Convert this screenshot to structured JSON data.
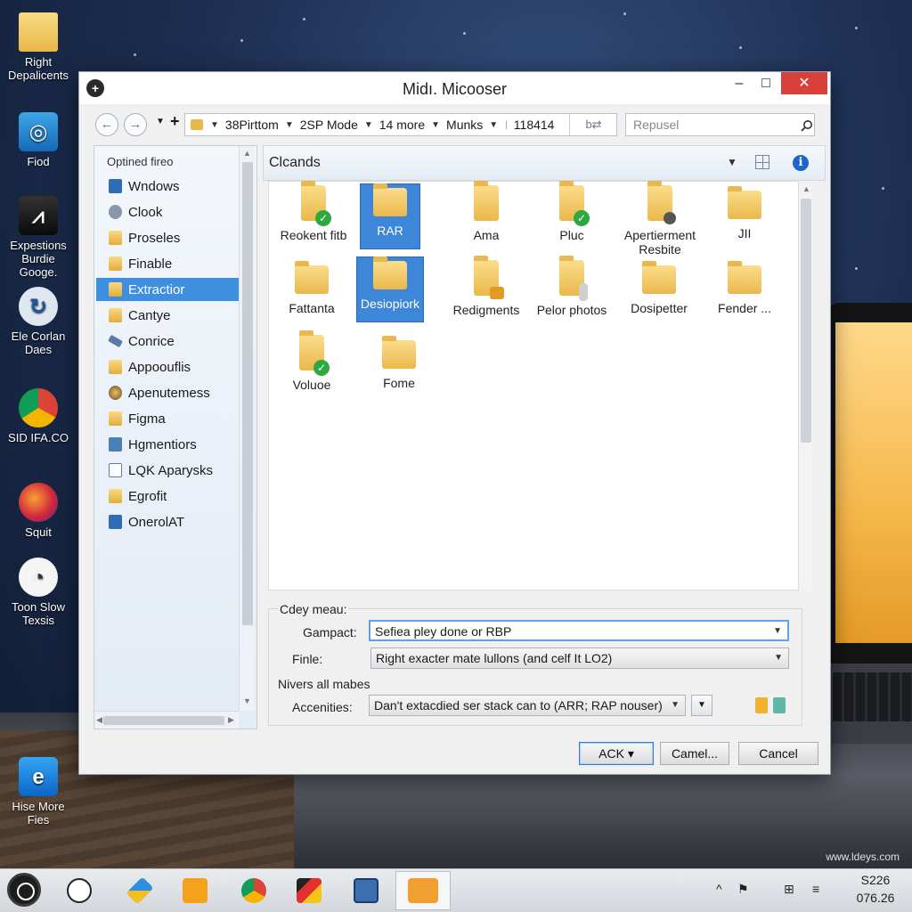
{
  "desktop": {
    "icons": [
      {
        "label": "Right Depalicents",
        "icon": "folder-icon"
      },
      {
        "label": "Fiod",
        "icon": "app-icon"
      },
      {
        "label": "Expestions Burdie Googe.",
        "icon": "media-icon"
      },
      {
        "label": "Ele Corlan Daes",
        "icon": "sync-icon"
      },
      {
        "label": "SID IFA.CO",
        "icon": "chrome-icon"
      },
      {
        "label": "Squit",
        "icon": "orb-icon"
      },
      {
        "label": "Toon Slow Texsis",
        "icon": "clock-icon"
      },
      {
        "label": "Hise More Fies",
        "icon": "ie-icon"
      }
    ],
    "watermark": "www.ldeys.com"
  },
  "dialog": {
    "title": "Midı. Micooser",
    "window_controls": {
      "minimize": "–",
      "maximize": "□",
      "close": "✕"
    },
    "toolbar": {
      "back": "←",
      "forward": "→",
      "plus": "+",
      "address_segments": [
        "38Pirttom",
        "2SP Mode",
        "14 more",
        "Munks",
        "118414"
      ],
      "tools_label": "b⇄",
      "search_placeholder": "Repusel"
    },
    "nav": {
      "header": "Optined fireo",
      "items": [
        {
          "label": "Wndows",
          "icon": "blue",
          "selected": false
        },
        {
          "label": "Clook",
          "icon": "gray",
          "selected": false
        },
        {
          "label": "Proseles",
          "icon": "folder",
          "selected": false
        },
        {
          "label": "Finable",
          "icon": "folder",
          "selected": false
        },
        {
          "label": "Extractior",
          "icon": "folder",
          "selected": true
        },
        {
          "label": "Cantye",
          "icon": "folder",
          "selected": false
        },
        {
          "label": "Conrice",
          "icon": "tool",
          "selected": false
        },
        {
          "label": "Appoouflis",
          "icon": "folder",
          "selected": false
        },
        {
          "label": "Apenutemess",
          "icon": "globe",
          "selected": false
        },
        {
          "label": "Figma",
          "icon": "folder",
          "selected": false
        },
        {
          "label": "Hgmentiors",
          "icon": "pic",
          "selected": false
        },
        {
          "label": "LQK Aparysks",
          "icon": "doc",
          "selected": false
        },
        {
          "label": "Egrofit",
          "icon": "folder",
          "selected": false
        },
        {
          "label": "OnerolAT",
          "icon": "blue",
          "selected": false
        }
      ]
    },
    "content": {
      "title": "Clcands",
      "files": [
        {
          "label": "Reokent fitb",
          "badge": "check",
          "selected": false
        },
        {
          "label": "RAR",
          "badge": "none",
          "selected": true
        },
        {
          "label": "Ama",
          "badge": "tall",
          "selected": false
        },
        {
          "label": "Pluc",
          "badge": "check",
          "selected": false
        },
        {
          "label": "Apertierment Resbite",
          "badge": "gear",
          "selected": false
        },
        {
          "label": "JII",
          "badge": "none",
          "selected": false
        },
        {
          "label": "Fattanta",
          "badge": "none",
          "selected": false
        },
        {
          "label": "Desiopiork",
          "badge": "none",
          "selected": true
        },
        {
          "label": "Redigments",
          "badge": "lock",
          "selected": false
        },
        {
          "label": "Pelor photos",
          "badge": "person",
          "selected": false
        },
        {
          "label": "Dosipetter",
          "badge": "none",
          "selected": false
        },
        {
          "label": "Fender ...",
          "badge": "none",
          "selected": false
        },
        {
          "label": "Voluoe",
          "badge": "check",
          "selected": false
        },
        {
          "label": "Fome",
          "badge": "none",
          "selected": false
        }
      ]
    },
    "options": {
      "section_label": "Cdey meau:",
      "gampact_label": "Gampact:",
      "gampact_value": "Sefiea pley done or RBP",
      "finle_label": "Finle:",
      "finle_value": "Right exacter mate lullons (and celf It LO2)",
      "nivers_label": "Nivers all mabes",
      "accenities_label": "Accenities:",
      "accenities_value": "Dan't extacdied ser stack can to (ARR; RAP nouser)"
    },
    "buttons": {
      "ack": "ACK ▾",
      "camel": "Camel...",
      "cancel": "Cancel"
    }
  },
  "taskbar": {
    "apps": [
      "timer-icon",
      "pen-icon",
      "office-icon",
      "chrome-icon",
      "paint-icon",
      "monitor-icon",
      "archive-icon"
    ],
    "tray": [
      "^",
      "⚑",
      "⊞",
      "≡"
    ],
    "clock_top": "S226",
    "clock_bottom": "076.26"
  },
  "colors": {
    "accent": "#3e8fe0",
    "close": "#d9403a",
    "folder": "#eab84c",
    "check": "#2ea843"
  }
}
